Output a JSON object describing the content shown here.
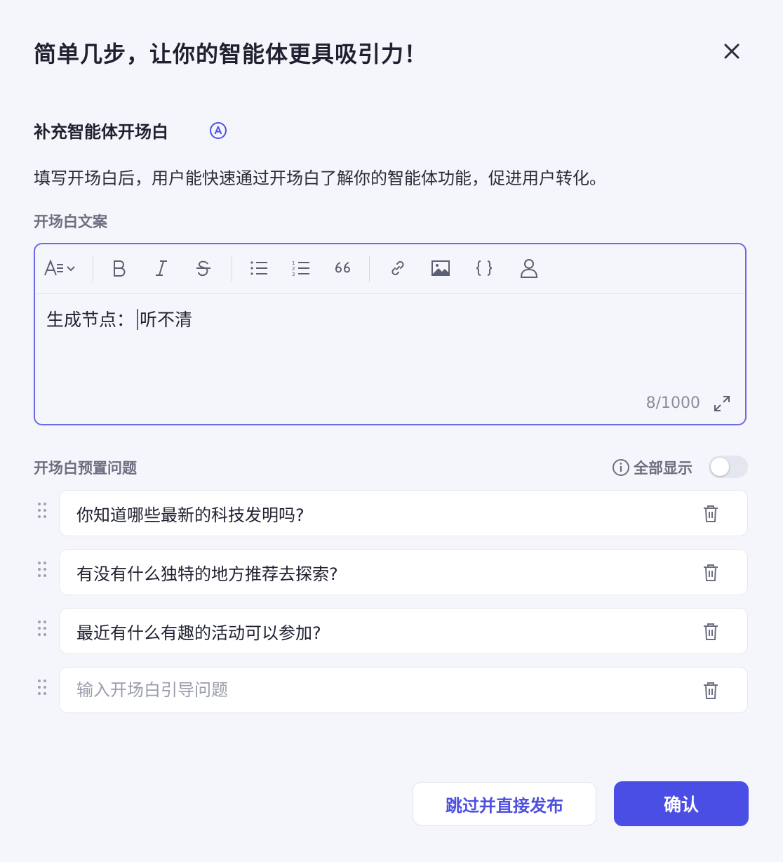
{
  "dialog": {
    "title": "简单几步，让你的智能体更具吸引力！",
    "close_icon": "close-icon"
  },
  "opening": {
    "section_title": "补充智能体开场白",
    "description": "填写开场白后，用户能快速通过开场白了解你的智能体功能，促进用户转化。",
    "copy_label": "开场白文案",
    "editor": {
      "text_before_caret": "生成节点：",
      "text_after_caret": "听不清",
      "counter": "8/1000",
      "toolbar": [
        "font-size-icon",
        "bold-icon",
        "italic-icon",
        "strikethrough-icon",
        "bullet-list-icon",
        "numbered-list-icon",
        "quote-icon",
        "link-icon",
        "image-icon",
        "code-braces-icon",
        "user-icon"
      ]
    }
  },
  "preset": {
    "label": "开场白预置问题",
    "show_all_label": "全部显示",
    "show_all_enabled": false,
    "questions": [
      {
        "value": "你知道哪些最新的科技发明吗?",
        "placeholder": "输入开场白引导问题"
      },
      {
        "value": "有没有什么独特的地方推荐去探索?",
        "placeholder": "输入开场白引导问题"
      },
      {
        "value": "最近有什么有趣的活动可以参加?",
        "placeholder": "输入开场白引导问题"
      },
      {
        "value": "",
        "placeholder": "输入开场白引导问题"
      }
    ]
  },
  "footer": {
    "skip_label": "跳过并直接发布",
    "confirm_label": "确认"
  },
  "colors": {
    "accent": "#4b4ee5",
    "background": "#f5f6fb",
    "editor_border": "#6b6ae6"
  }
}
